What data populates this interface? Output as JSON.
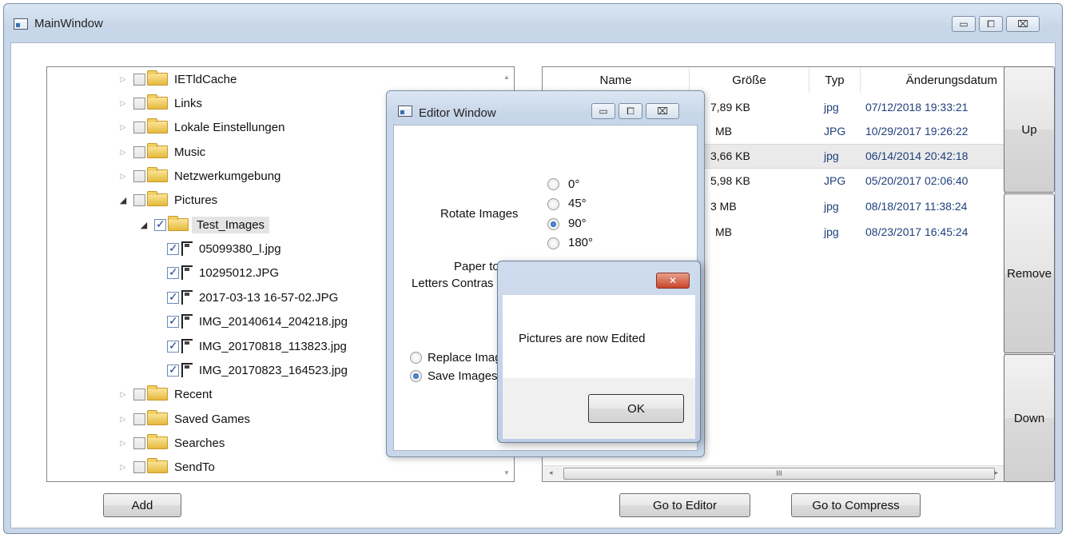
{
  "main_window": {
    "title": "MainWindow",
    "caption": {
      "minimize": "▭",
      "maximize": "⧠",
      "close": "⌧"
    }
  },
  "tree": {
    "items": [
      {
        "label": "IETldCache",
        "expander": "▷",
        "checked": false
      },
      {
        "label": "Links",
        "expander": "▷",
        "checked": false
      },
      {
        "label": "Lokale Einstellungen",
        "expander": "▷",
        "checked": false
      },
      {
        "label": "Music",
        "expander": "▷",
        "checked": false
      },
      {
        "label": "Netzwerkumgebung",
        "expander": "▷",
        "checked": false
      },
      {
        "label": "Pictures",
        "expander": "◢",
        "checked": false
      },
      {
        "label": "Test_Images",
        "expander": "◢",
        "checked": true
      },
      {
        "label": "05099380_l.jpg",
        "checked": true
      },
      {
        "label": "10295012.JPG",
        "checked": true
      },
      {
        "label": "2017-03-13 16-57-02.JPG",
        "checked": true
      },
      {
        "label": "IMG_20140614_204218.jpg",
        "checked": true
      },
      {
        "label": "IMG_20170818_113823.jpg",
        "checked": true
      },
      {
        "label": "IMG_20170823_164523.jpg",
        "checked": true
      },
      {
        "label": "Recent",
        "expander": "▷",
        "checked": false
      },
      {
        "label": "Saved Games",
        "expander": "▷",
        "checked": false
      },
      {
        "label": "Searches",
        "expander": "▷",
        "checked": false
      },
      {
        "label": "SendTo",
        "expander": "▷",
        "checked": false
      }
    ],
    "scroll_up": "▲",
    "scroll_down": "▼"
  },
  "list": {
    "columns": [
      "Name",
      "Größe",
      "Typ",
      "Änderungsdatum"
    ],
    "rows": [
      {
        "size": "7,89 KB",
        "type": "jpg",
        "date": "07/12/2018 19:33:21"
      },
      {
        "size": "MB",
        "type": "JPG",
        "date": "10/29/2017 19:26:22"
      },
      {
        "size": "3,66 KB",
        "type": "jpg",
        "date": "06/14/2014 20:42:18"
      },
      {
        "size": "5,98 KB",
        "type": "JPG",
        "date": "05/20/2017 02:06:40"
      },
      {
        "size": "3 MB",
        "type": "jpg",
        "date": "08/18/2017 11:38:24"
      },
      {
        "size": "MB",
        "type": "jpg",
        "date": "08/23/2017 16:45:24"
      }
    ],
    "scroll_left": "◂",
    "scroll_right": "▸",
    "scroll_thumb": "III"
  },
  "side_buttons": {
    "up": "Up",
    "remove": "Remove",
    "down": "Down"
  },
  "bottom_buttons": {
    "add": "Add",
    "go_to_editor": "Go to Editor",
    "go_to_compress": "Go to Compress"
  },
  "editor": {
    "title": "Editor Window",
    "rotate_label": "Rotate Images",
    "rotate_options": [
      {
        "label": "0°",
        "selected": false
      },
      {
        "label": "45°",
        "selected": false
      },
      {
        "label": "90°",
        "selected": true
      },
      {
        "label": "180°",
        "selected": false
      }
    ],
    "paper_label": "Paper to",
    "contrast_label": "Letters Contras",
    "replace_label": "Replace Imag",
    "save_label": "Save Images"
  },
  "message_box": {
    "close": "✕",
    "text": "Pictures are now Edited",
    "ok": "OK"
  }
}
